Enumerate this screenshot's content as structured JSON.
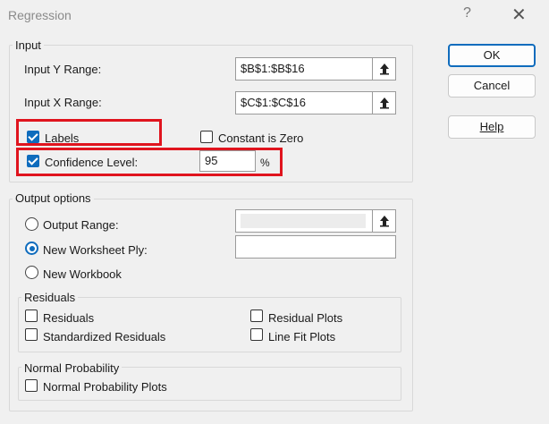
{
  "window": {
    "title": "Regression",
    "help_glyph": "?",
    "close_glyph": "✕"
  },
  "buttons": {
    "ok": "OK",
    "cancel": "Cancel",
    "help": "Help"
  },
  "input": {
    "legend": "Input",
    "y_range": {
      "label": "Input Y Range:",
      "value": "$B$1:$B$16"
    },
    "x_range": {
      "label": "Input X Range:",
      "value": "$C$1:$C$16"
    },
    "labels": {
      "label": "Labels",
      "checked": true
    },
    "constant_zero": {
      "label": "Constant is Zero",
      "checked": false
    },
    "confidence": {
      "label": "Confidence Level:",
      "checked": true,
      "value": "95",
      "unit": "%"
    }
  },
  "output": {
    "legend": "Output options",
    "output_range": {
      "label": "Output Range:",
      "selected": false,
      "value": ""
    },
    "new_ply": {
      "label": "New Worksheet Ply:",
      "selected": true,
      "value": ""
    },
    "new_workbook": {
      "label": "New Workbook",
      "selected": false
    }
  },
  "residuals": {
    "legend": "Residuals",
    "residuals": "Residuals",
    "residual_plots": "Residual Plots",
    "standardized": "Standardized Residuals",
    "line_fit": "Line Fit Plots"
  },
  "normal": {
    "legend": "Normal Probability",
    "plots": "Normal Probability Plots"
  },
  "colors": {
    "accent": "#0f6cbd",
    "highlight": "#e0141e"
  }
}
